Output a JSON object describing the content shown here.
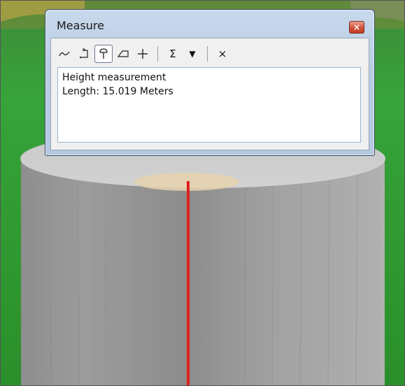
{
  "window": {
    "title": "Measure",
    "close_glyph": "×"
  },
  "toolbar": {
    "tools": [
      {
        "name": "measure-line-icon",
        "glyph": "∼"
      },
      {
        "name": "measure-area-icon",
        "glyph": "⬚"
      },
      {
        "name": "measure-height-icon",
        "glyph": "⸵"
      },
      {
        "name": "measure-feature-icon",
        "glyph": "▱"
      },
      {
        "name": "crosshair-icon",
        "glyph": "+"
      },
      {
        "name": "sum-icon",
        "glyph": "Σ"
      },
      {
        "name": "dropdown-icon",
        "glyph": "▼"
      },
      {
        "name": "clear-icon",
        "glyph": "×"
      }
    ],
    "active_tool": "measure-height-icon"
  },
  "result": {
    "line1": "Height measurement",
    "line2": "Length: 15.019 Meters"
  },
  "colors": {
    "measure_line": "#e02020",
    "ground": "#2f8f2f",
    "cylinder": "#9a9a9a"
  }
}
